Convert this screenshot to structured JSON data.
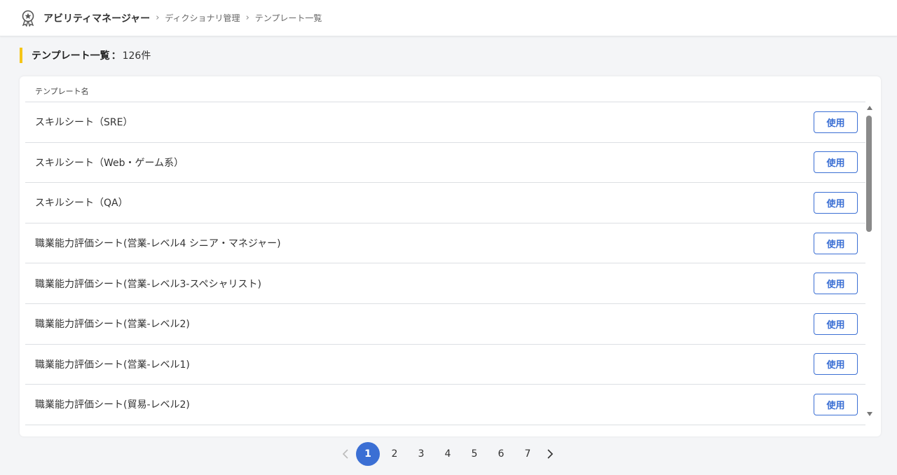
{
  "header": {
    "app_name": "アビリティマネージャー",
    "breadcrumbs": [
      "ディクショナリ管理",
      "テンプレート一覧"
    ],
    "icon": "award-badge-icon"
  },
  "page": {
    "title": "テンプレート一覧",
    "colon": "：",
    "count": "126件",
    "accent_color": "#f5c518"
  },
  "table": {
    "column_header": "テンプレート名",
    "action_label": "使用",
    "rows": [
      "スキルシート（SRE）",
      "スキルシート（Web・ゲーム系）",
      "スキルシート（QA）",
      "職業能力評価シート(営業-レベル4 シニア・マネジャー)",
      "職業能力評価シート(営業-レベル3-スペシャリスト)",
      "職業能力評価シート(営業-レベル2)",
      "職業能力評価シート(営業-レベル1)",
      "職業能力評価シート(貿易-レベル2)"
    ]
  },
  "pagination": {
    "pages": [
      "1",
      "2",
      "3",
      "4",
      "5",
      "6",
      "7"
    ],
    "current": "1",
    "prev_icon": "chevron-left-icon",
    "next_icon": "chevron-right-icon",
    "active_color": "#3b6fd4"
  }
}
